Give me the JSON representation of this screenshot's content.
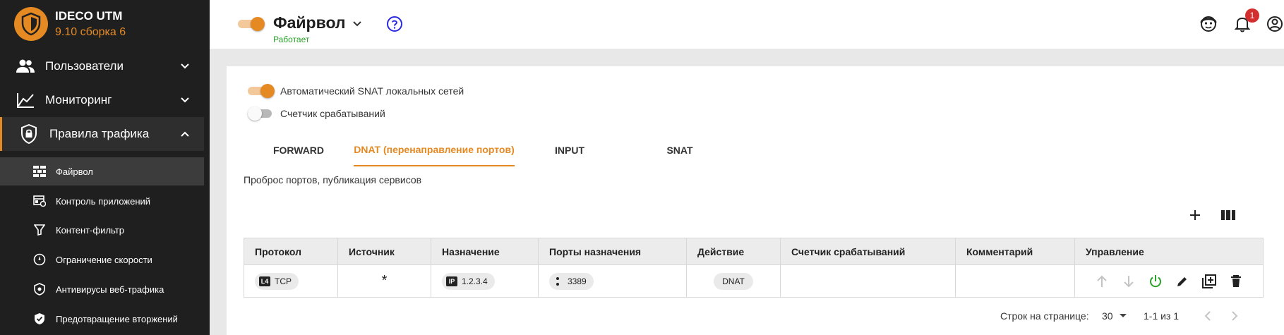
{
  "app": {
    "name": "IDECO UTM",
    "version": "9.10 сборка 6"
  },
  "sidebar": {
    "groups": [
      {
        "label": "Пользователи",
        "icon": "users-icon"
      },
      {
        "label": "Мониторинг",
        "icon": "chart-line-icon"
      },
      {
        "label": "Правила трафика",
        "icon": "shield-lock-icon"
      }
    ],
    "items": [
      {
        "label": "Файрвол",
        "icon": "firewall-icon"
      },
      {
        "label": "Контроль приложений",
        "icon": "app-control-icon"
      },
      {
        "label": "Контент-фильтр",
        "icon": "filter-icon"
      },
      {
        "label": "Ограничение скорости",
        "icon": "speedometer-icon"
      },
      {
        "label": "Антивирусы веб-трафика",
        "icon": "virus-shield-icon"
      },
      {
        "label": "Предотвращение вторжений",
        "icon": "shield-check-icon"
      }
    ]
  },
  "header": {
    "title": "Файрвол",
    "status": "Работает",
    "notifications_count": "1"
  },
  "options": {
    "auto_snat": {
      "label": "Автоматический SNAT локальных сетей",
      "enabled": true
    },
    "hit_counter": {
      "label": "Счетчик срабатываний",
      "enabled": false
    }
  },
  "tabs": [
    {
      "label": "FORWARD"
    },
    {
      "label": "DNAT (перенаправление портов)"
    },
    {
      "label": "INPUT"
    },
    {
      "label": "SNAT"
    }
  ],
  "description": "Проброс портов, публикация сервисов",
  "table": {
    "headers": [
      "Протокол",
      "Источник",
      "Назначение",
      "Порты назначения",
      "Действие",
      "Счетчик срабатываний",
      "Комментарий",
      "Управление"
    ],
    "row": {
      "protocol_badge": "L4",
      "protocol": "TCP",
      "source": "*",
      "dest_badge": "IP",
      "destination": "1.2.3.4",
      "port": "3389",
      "action": "DNAT",
      "counter": "",
      "comment": ""
    }
  },
  "pagination": {
    "rows_label": "Строк на странице:",
    "rows_value": "30",
    "range": "1-1 из 1"
  },
  "colors": {
    "accent": "#e58a23",
    "sidebar_bg": "#1f1f1f",
    "status_ok": "#27a327",
    "badge": "#d32f2f"
  }
}
